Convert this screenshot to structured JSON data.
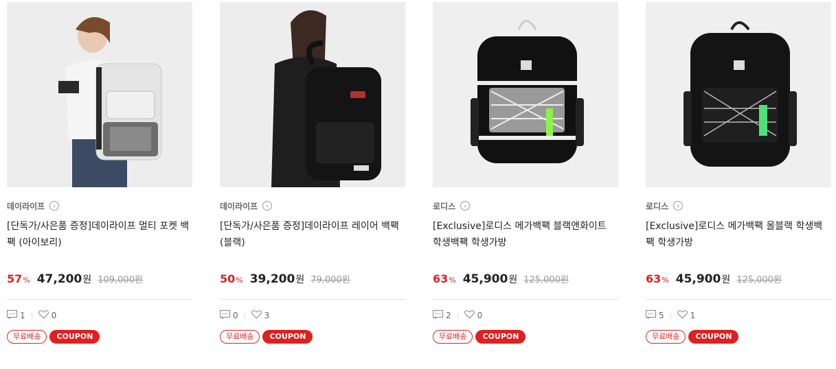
{
  "products": [
    {
      "brand": "데이라이프",
      "title": "[단독가/사은품 증정]데이라이프 멀티 포켓 백팩 (아이보리)",
      "discount": "57",
      "price": "47,200",
      "original_price": "109,000원",
      "reviews": "1",
      "likes": "0",
      "image": "model-white-backpack"
    },
    {
      "brand": "데이라이프",
      "title": "[단독가/사은품 증정]데이라이프 레이어 백팩 (블랙)",
      "discount": "50",
      "price": "39,200",
      "original_price": "79,000원",
      "reviews": "0",
      "likes": "3",
      "image": "model-black-backpack"
    },
    {
      "brand": "로디스",
      "title": "[Exclusive]로디스 메가백팩 블랙앤화이트 학생백팩 학생가방",
      "discount": "63",
      "price": "45,900",
      "original_price": "125,000원",
      "reviews": "2",
      "likes": "0",
      "image": "black-white-backpack"
    },
    {
      "brand": "로디스",
      "title": "[Exclusive]로디스 메가백팩 올블랙 학생백팩 학생가방",
      "discount": "63",
      "price": "45,900",
      "original_price": "125,000원",
      "reviews": "5",
      "likes": "1",
      "image": "all-black-backpack"
    }
  ],
  "labels": {
    "percent": "%",
    "won": "원",
    "free_shipping": "무료배송",
    "coupon": "COUPON"
  },
  "colors": {
    "accent": "#e02020",
    "thumb_bg": "#ececec"
  }
}
